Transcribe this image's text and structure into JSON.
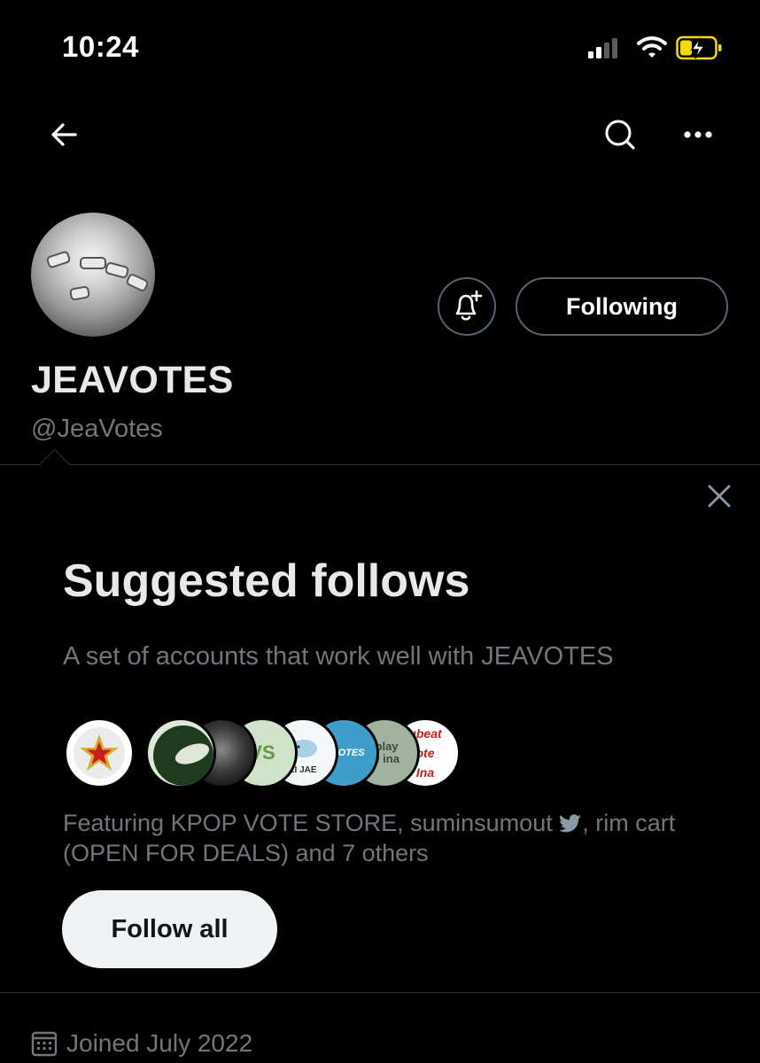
{
  "status_bar": {
    "time": "10:24"
  },
  "profile": {
    "display_name": "JEAVOTES",
    "handle": "@JeaVotes",
    "following_label": "Following"
  },
  "suggested": {
    "title": "Suggested follows",
    "subtitle": "A set of accounts that work well with JEAVOTES",
    "featuring_text": "Featuring KPOP VOTE STORE, suminsumout ",
    "featuring_text_2": ", rim cart (OPEN FOR DEALS) and 7 others",
    "follow_all_label": "Follow all",
    "face_labels": {
      "face_5": "LI JAE",
      "face_6": "P VOTES",
      "face_7_line1": "rplay",
      "face_7_line2": "te ina",
      "face_8_line1": "ubeat",
      "face_8_line2": "ote",
      "face_8_line3": "Ina",
      "face_4": "VS"
    }
  },
  "joined": {
    "text": "Joined July 2022"
  },
  "colors": {
    "background": "#000000",
    "muted": "#71767b",
    "divider": "#2f3336",
    "battery_yellow": "#f5d90a"
  },
  "icons": [
    "back-arrow-icon",
    "search-icon",
    "more-icon",
    "bell-plus-icon",
    "close-icon",
    "bird-icon",
    "calendar-icon"
  ]
}
